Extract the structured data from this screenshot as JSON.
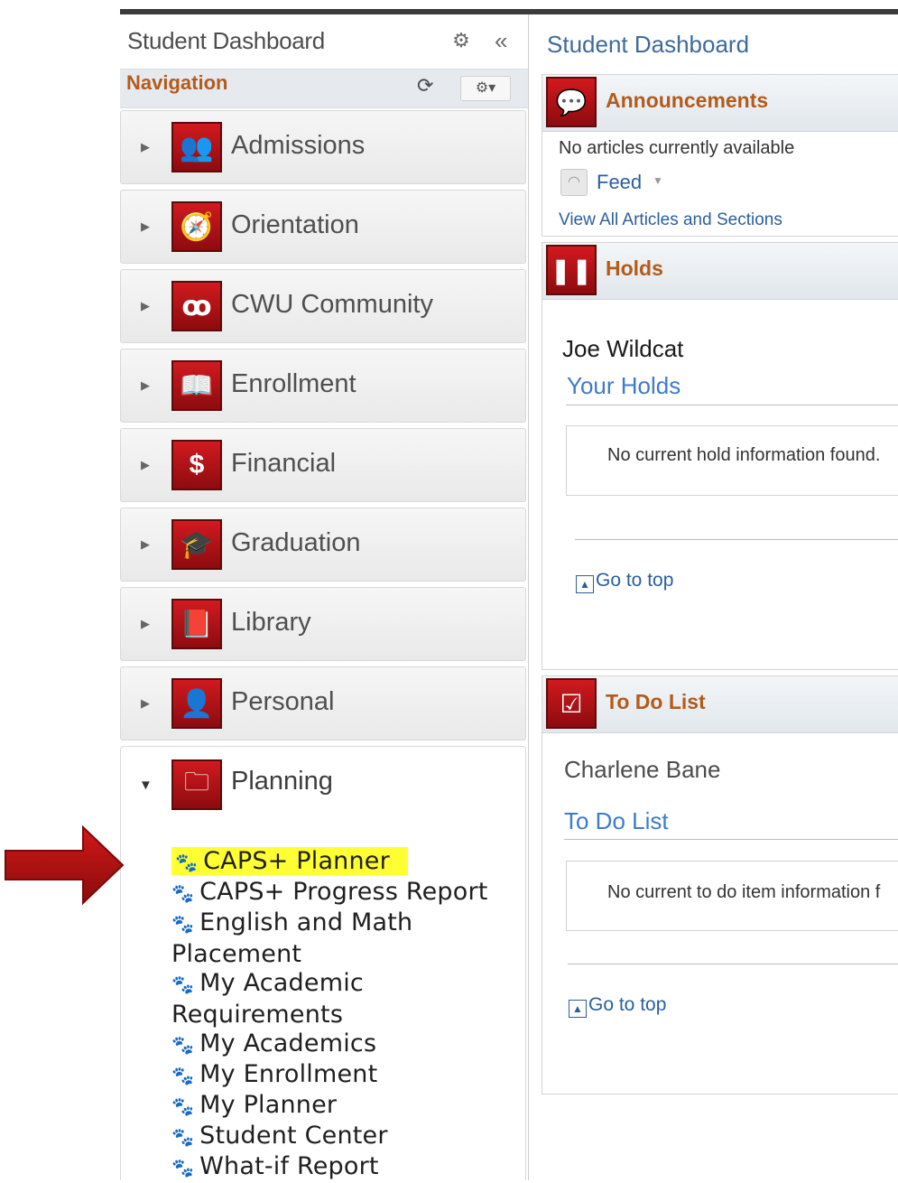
{
  "left_panel": {
    "title": "Student Dashboard",
    "collapse_icon": "«",
    "gear_icon": "⚙",
    "navigation_label": "Navigation",
    "refresh_icon": "⟳",
    "menu_icon": "⚙▾"
  },
  "nav_items": [
    {
      "label": "Admissions",
      "icon": "people-icon",
      "glyph": "👥"
    },
    {
      "label": "Orientation",
      "icon": "compass-icon",
      "glyph": "🧭"
    },
    {
      "label": "CWU Community",
      "icon": "community-icon",
      "glyph": "ꝏ"
    },
    {
      "label": "Enrollment",
      "icon": "book-icon",
      "glyph": "📖"
    },
    {
      "label": "Financial",
      "icon": "dollar-icon",
      "glyph": "$"
    },
    {
      "label": "Graduation",
      "icon": "graduation-cap-icon",
      "glyph": "🎓"
    },
    {
      "label": "Library",
      "icon": "library-book-icon",
      "glyph": "📕"
    },
    {
      "label": "Personal",
      "icon": "person-icon",
      "glyph": "👤"
    }
  ],
  "planning": {
    "label": "Planning",
    "links": [
      {
        "text": "CAPS+ Planner",
        "highlighted": true
      },
      {
        "text": "CAPS+ Progress Report"
      },
      {
        "text": "English and Math",
        "text2": "Placement"
      },
      {
        "text": "My Academic",
        "text2": "Requirements"
      },
      {
        "text": "My Academics"
      },
      {
        "text": "My Enrollment"
      },
      {
        "text": "My Planner"
      },
      {
        "text": "Student Center"
      },
      {
        "text": "What-if Report"
      }
    ]
  },
  "right_panel": {
    "title": "Student Dashboard",
    "announcements": {
      "title": "Announcements",
      "no_articles": "No articles currently available",
      "feed_label": "Feed",
      "view_all": "View All Articles and Sections"
    },
    "holds": {
      "title": "Holds",
      "name": "Joe Wildcat",
      "subtitle": "Your Holds",
      "empty_msg": "No current hold information found.",
      "go_to_top": "Go to top"
    },
    "todo": {
      "title": "To Do List",
      "name": "Charlene Bane",
      "subtitle": "To Do List",
      "empty_msg": "No current to do item information f",
      "go_to_top": "Go to top"
    }
  },
  "colors": {
    "accent_red": "#b01818",
    "header_orange": "#b35b1c",
    "link_blue": "#2a5f9e",
    "highlight_yellow": "#ffff33"
  }
}
